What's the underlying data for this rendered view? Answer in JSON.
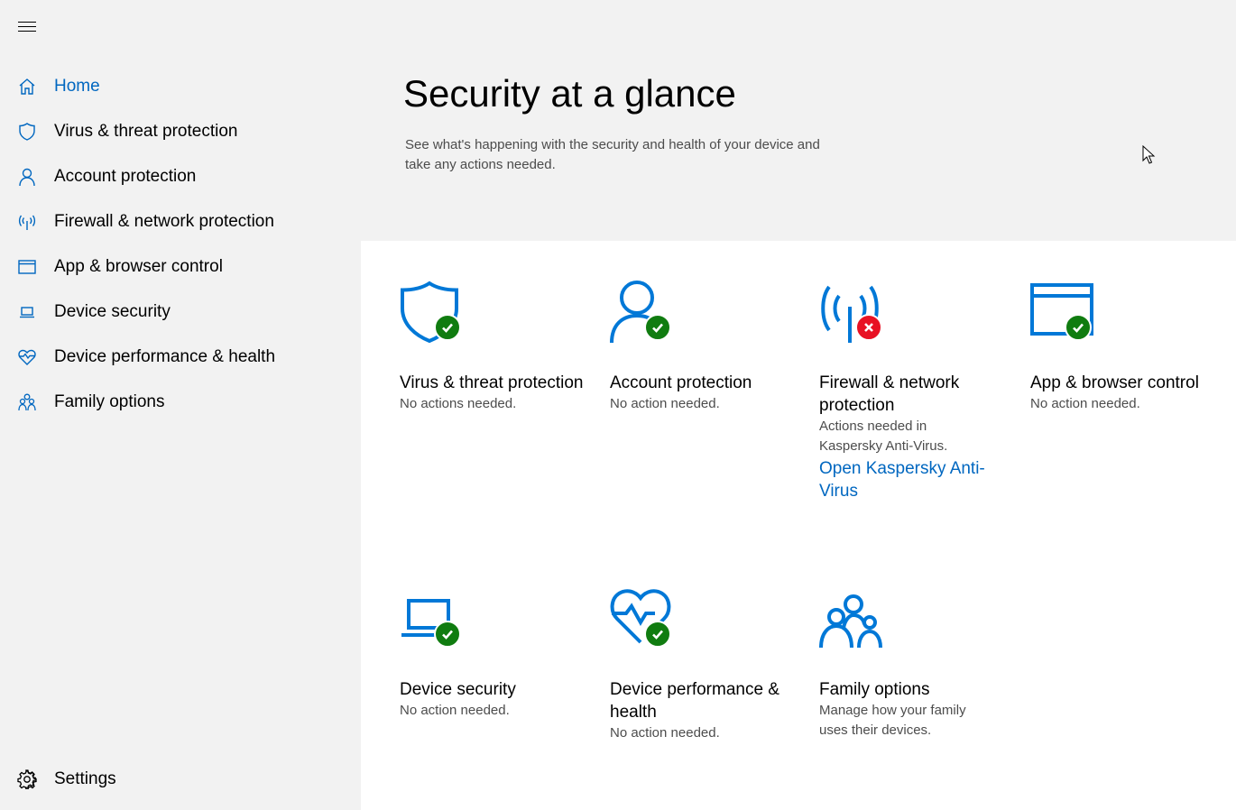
{
  "sidebar": {
    "menu_icon": "hamburger-menu-icon",
    "items": [
      {
        "label": "Home",
        "icon": "home-icon",
        "active": true
      },
      {
        "label": "Virus & threat protection",
        "icon": "shield-icon"
      },
      {
        "label": "Account protection",
        "icon": "person-icon"
      },
      {
        "label": "Firewall & network protection",
        "icon": "antenna-icon"
      },
      {
        "label": "App & browser control",
        "icon": "browser-window-icon"
      },
      {
        "label": "Device security",
        "icon": "laptop-icon"
      },
      {
        "label": "Device performance & health",
        "icon": "heart-pulse-icon"
      },
      {
        "label": "Family options",
        "icon": "family-icon"
      }
    ],
    "settings_label": "Settings"
  },
  "header": {
    "title": "Security at a glance",
    "subtitle": "See what's happening with the security and health of your device and take any actions needed."
  },
  "tiles": [
    {
      "title": "Virus & threat protection",
      "status": "No actions needed.",
      "state": "ok"
    },
    {
      "title": "Account protection",
      "status": "No action needed.",
      "state": "ok"
    },
    {
      "title": "Firewall & network protection",
      "status": "Actions needed in Kaspersky Anti-Virus.",
      "link": "Open Kaspersky Anti-Virus",
      "state": "error"
    },
    {
      "title": "App & browser control",
      "status": "No action needed.",
      "state": "ok"
    },
    {
      "title": "Device security",
      "status": "No action needed.",
      "state": "ok"
    },
    {
      "title": "Device performance & health",
      "status": "No action needed.",
      "state": "ok"
    },
    {
      "title": "Family options",
      "status": "Manage how your family uses their devices."
    }
  ],
  "colors": {
    "accent": "#0067c0",
    "ok": "#107c10",
    "error": "#e81123",
    "icon_blue": "#0078d7"
  }
}
